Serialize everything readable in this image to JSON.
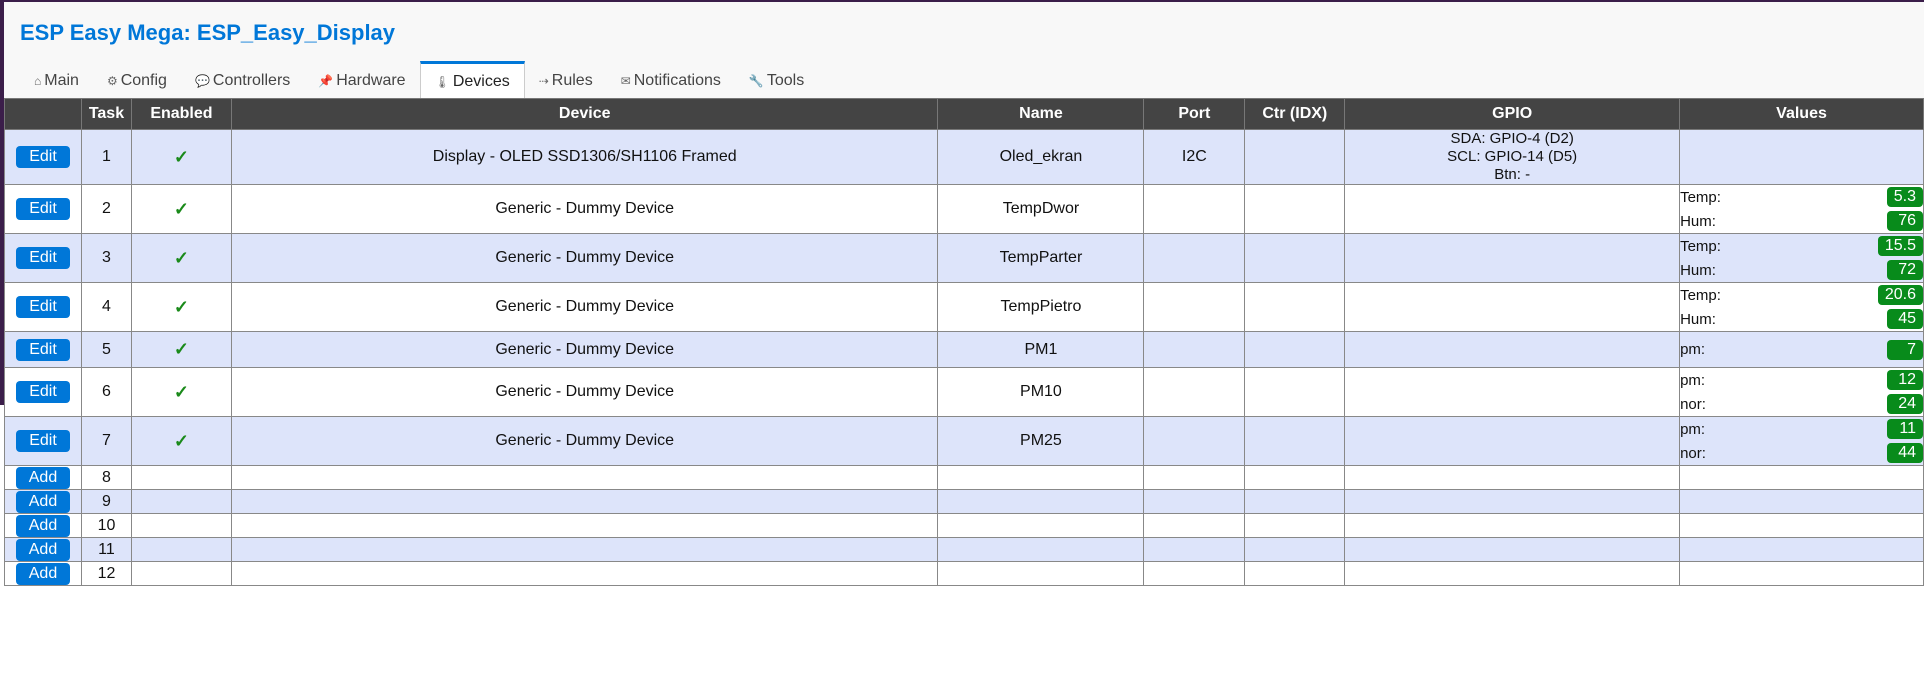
{
  "app": {
    "title": "ESP Easy Mega: ESP_Easy_Display"
  },
  "tabs": [
    {
      "icon": "⌂",
      "icon_name": "home-icon",
      "label": "Main"
    },
    {
      "icon": "⚙",
      "icon_name": "gear-icon",
      "label": "Config"
    },
    {
      "icon": "💬",
      "icon_name": "speech-bubble-icon",
      "label": "Controllers"
    },
    {
      "icon": "📌",
      "icon_name": "pin-icon",
      "label": "Hardware"
    },
    {
      "icon": "🌡",
      "icon_name": "thermometer-icon",
      "label": "Devices",
      "active": true
    },
    {
      "icon": "⇢",
      "icon_name": "arrow-icon",
      "label": "Rules"
    },
    {
      "icon": "✉",
      "icon_name": "envelope-icon",
      "label": "Notifications"
    },
    {
      "icon": "🔧",
      "icon_name": "wrench-icon",
      "label": "Tools"
    }
  ],
  "columns": [
    "",
    "Task",
    "Enabled",
    "Device",
    "Name",
    "Port",
    "Ctr (IDX)",
    "GPIO",
    "Values"
  ],
  "colors": {
    "accent": "#0077d8",
    "header_bg": "#444444",
    "value_badge": "#088b1b",
    "enabled_check": "#1a8a1a",
    "row_alt": "#dde4fa"
  },
  "rows": [
    {
      "button": "Edit",
      "task": "1",
      "enabled": "✓",
      "device": "Display - OLED SSD1306/SH1106 Framed",
      "name": "Oled_ekran",
      "port": "I2C",
      "ctr": "",
      "gpio": [
        "SDA: GPIO-4 (D2)",
        "SCL: GPIO-14 (D5)",
        "Btn: -"
      ],
      "values": []
    },
    {
      "button": "Edit",
      "task": "2",
      "enabled": "✓",
      "device": "Generic - Dummy Device",
      "name": "TempDwor",
      "port": "",
      "ctr": "",
      "gpio": [],
      "values": [
        {
          "label": "Temp:",
          "value": "5.3"
        },
        {
          "label": "Hum:",
          "value": "76"
        }
      ]
    },
    {
      "button": "Edit",
      "task": "3",
      "enabled": "✓",
      "device": "Generic - Dummy Device",
      "name": "TempParter",
      "port": "",
      "ctr": "",
      "gpio": [],
      "values": [
        {
          "label": "Temp:",
          "value": "15.5"
        },
        {
          "label": "Hum:",
          "value": "72"
        }
      ]
    },
    {
      "button": "Edit",
      "task": "4",
      "enabled": "✓",
      "device": "Generic - Dummy Device",
      "name": "TempPietro",
      "port": "",
      "ctr": "",
      "gpio": [],
      "values": [
        {
          "label": "Temp:",
          "value": "20.6"
        },
        {
          "label": "Hum:",
          "value": "45"
        }
      ]
    },
    {
      "button": "Edit",
      "task": "5",
      "enabled": "✓",
      "device": "Generic - Dummy Device",
      "name": "PM1",
      "port": "",
      "ctr": "",
      "gpio": [],
      "values": [
        {
          "label": "pm:",
          "value": "7"
        }
      ]
    },
    {
      "button": "Edit",
      "task": "6",
      "enabled": "✓",
      "device": "Generic - Dummy Device",
      "name": "PM10",
      "port": "",
      "ctr": "",
      "gpio": [],
      "values": [
        {
          "label": "pm:",
          "value": "12"
        },
        {
          "label": "nor:",
          "value": "24"
        }
      ]
    },
    {
      "button": "Edit",
      "task": "7",
      "enabled": "✓",
      "device": "Generic - Dummy Device",
      "name": "PM25",
      "port": "",
      "ctr": "",
      "gpio": [],
      "values": [
        {
          "label": "pm:",
          "value": "11"
        },
        {
          "label": "nor:",
          "value": "44"
        }
      ]
    },
    {
      "button": "Add",
      "task": "8",
      "enabled": "",
      "device": "",
      "name": "",
      "port": "",
      "ctr": "",
      "gpio": [],
      "values": []
    },
    {
      "button": "Add",
      "task": "9",
      "enabled": "",
      "device": "",
      "name": "",
      "port": "",
      "ctr": "",
      "gpio": [],
      "values": []
    },
    {
      "button": "Add",
      "task": "10",
      "enabled": "",
      "device": "",
      "name": "",
      "port": "",
      "ctr": "",
      "gpio": [],
      "values": []
    },
    {
      "button": "Add",
      "task": "11",
      "enabled": "",
      "device": "",
      "name": "",
      "port": "",
      "ctr": "",
      "gpio": [],
      "values": []
    },
    {
      "button": "Add",
      "task": "12",
      "enabled": "",
      "device": "",
      "name": "",
      "port": "",
      "ctr": "",
      "gpio": [],
      "values": []
    }
  ]
}
